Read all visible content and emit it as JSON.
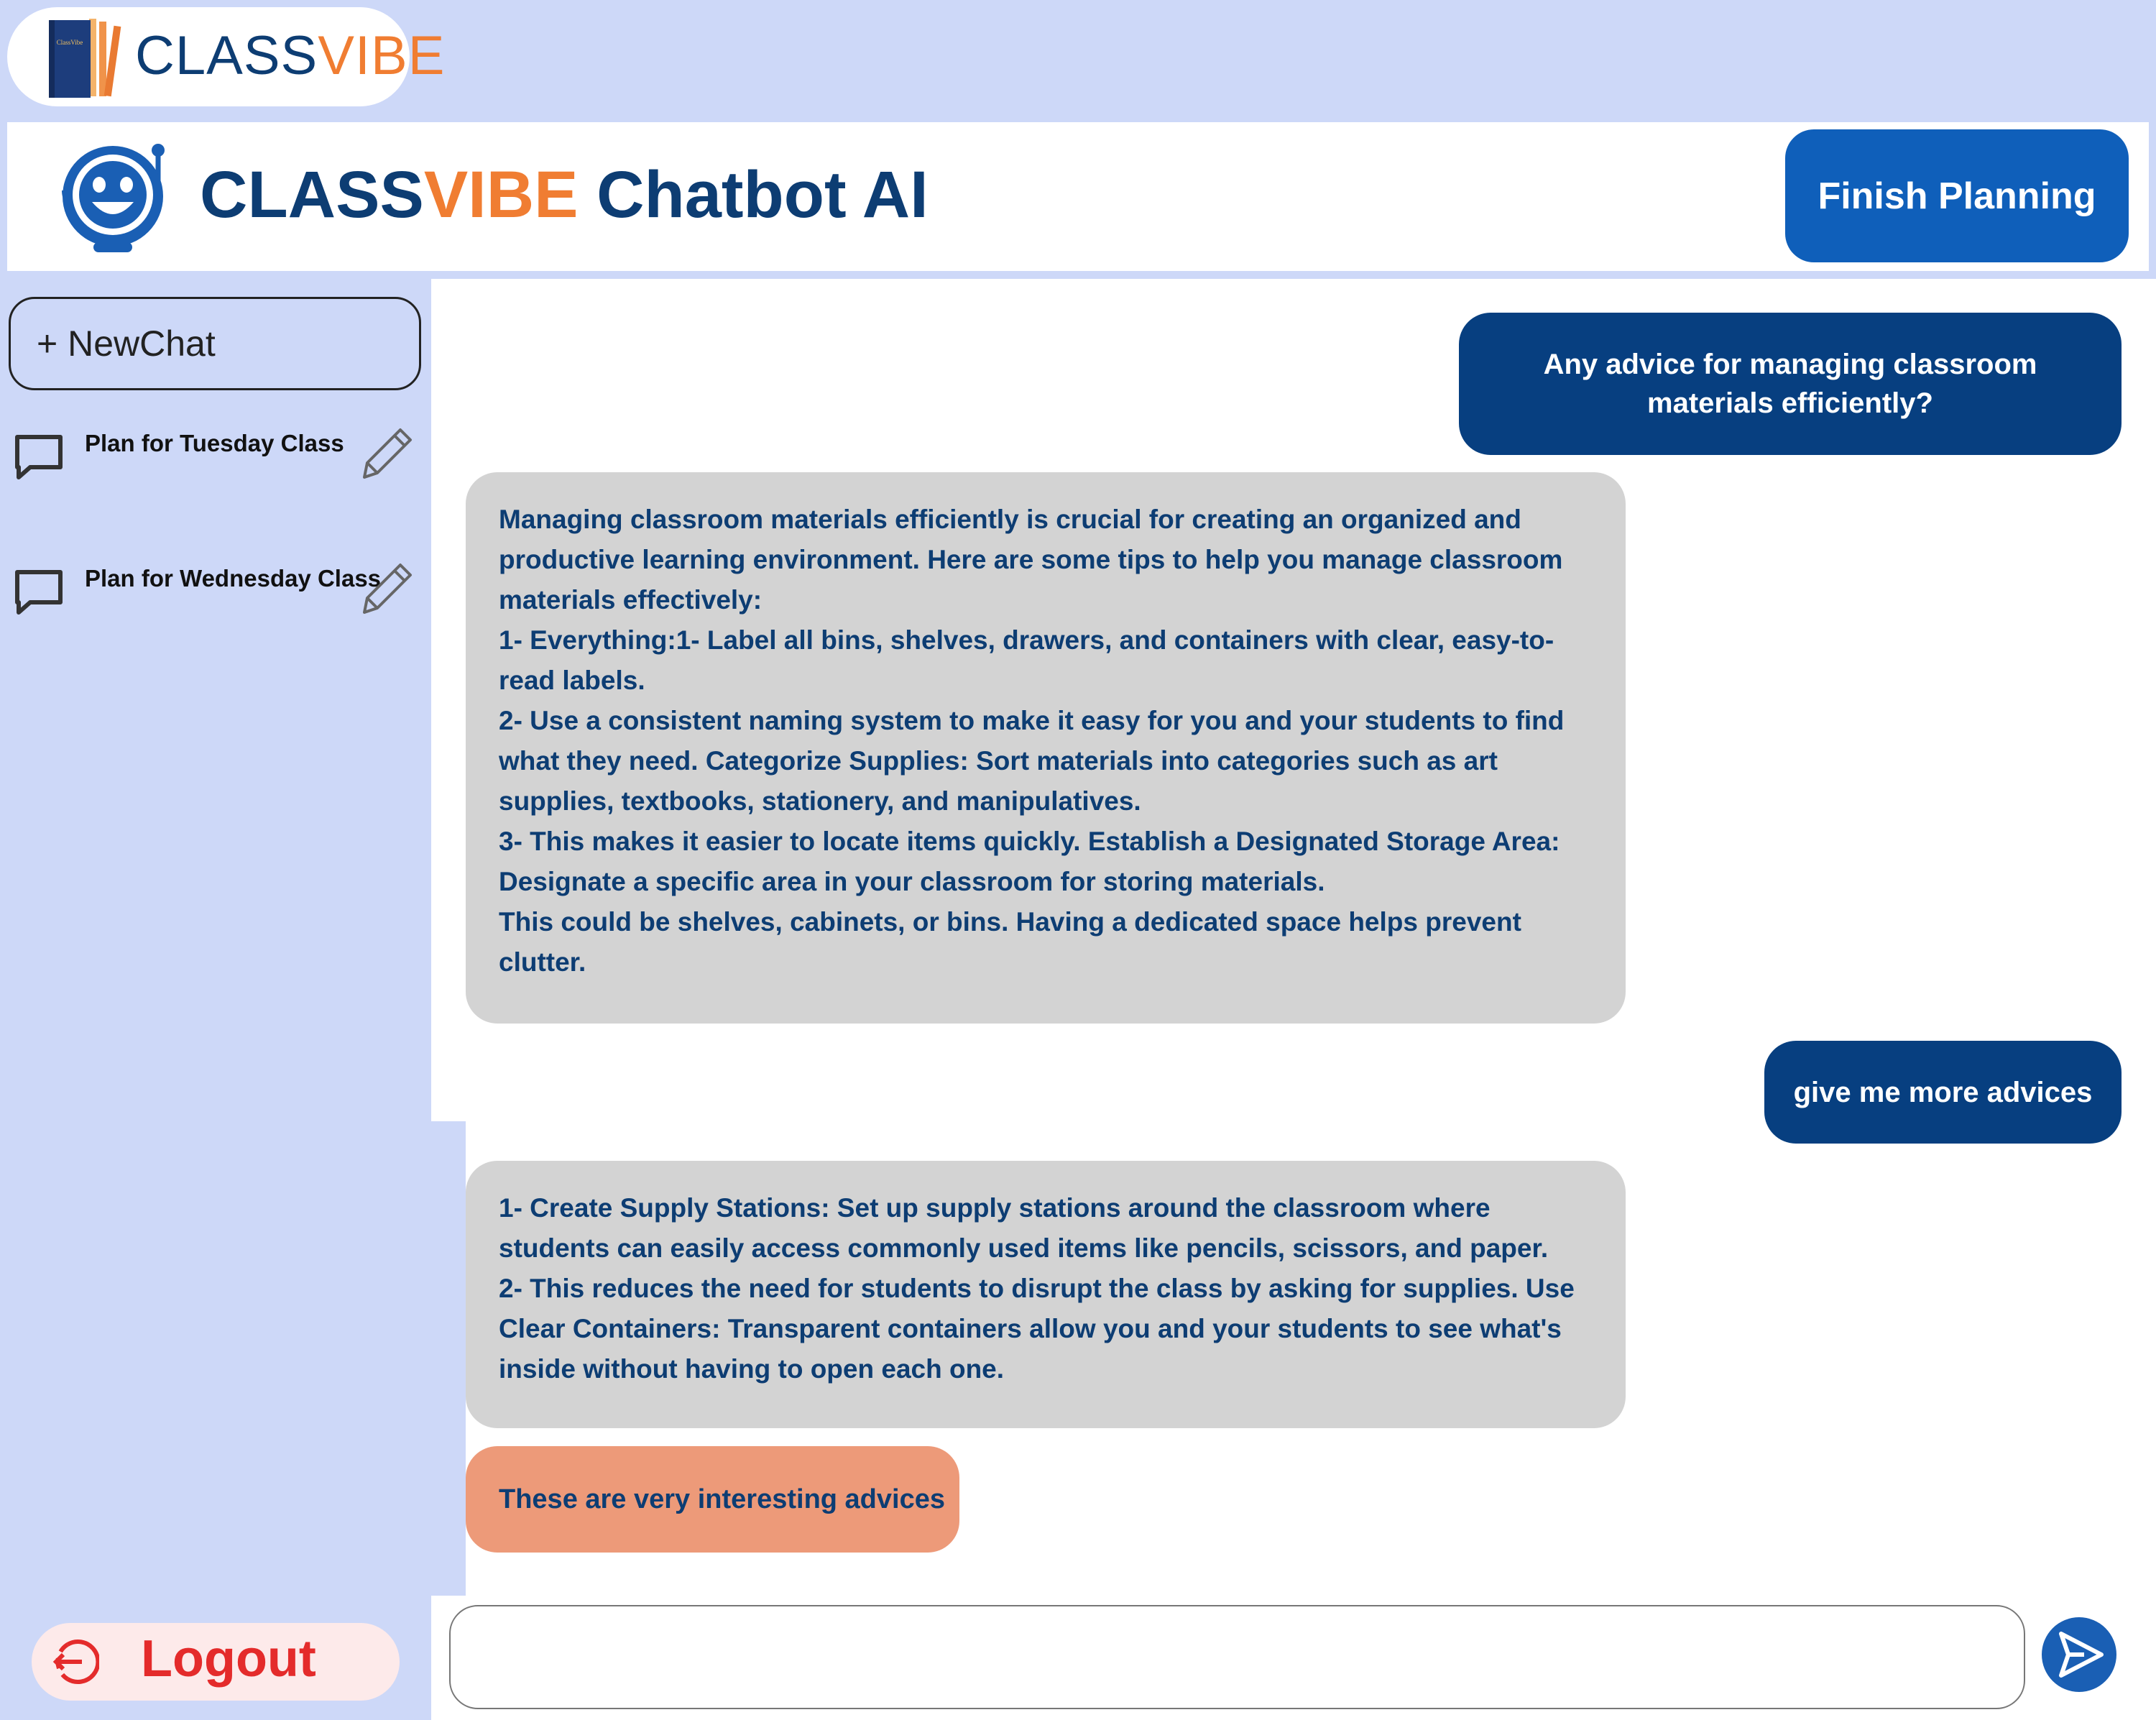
{
  "brand": {
    "logo_part1": "CLASS",
    "logo_part2": "VIBE",
    "book_text": "ClassVibe"
  },
  "header": {
    "title_part1": "CLASS",
    "title_part2": "VIBE",
    "title_part3": " Chatbot AI",
    "finish_button": "Finish Planning"
  },
  "sidebar": {
    "new_chat": "+ NewChat",
    "history": [
      {
        "label": "Plan for Tuesday Class"
      },
      {
        "label": "Plan for Wednesday Class"
      }
    ],
    "logout": "Logout"
  },
  "messages": [
    {
      "role": "user",
      "text": "Any advice for managing classroom materials efficiently?"
    },
    {
      "role": "bot",
      "text": "Managing classroom materials efficiently is crucial for creating an organized and productive learning environment. Here are some tips to help you manage classroom materials effectively:\n1- Everything:1- Label all bins, shelves, drawers, and containers with clear, easy-to-read labels.\n2- Use a consistent naming system to make it easy for you and your students to find what they need. Categorize Supplies: Sort materials into categories such as art supplies, textbooks, stationery, and manipulatives.\n3- This makes it easier to locate items quickly. Establish a Designated Storage Area: Designate a specific area in your classroom for storing materials.\nThis could be shelves, cabinets, or bins. Having a dedicated space helps prevent clutter."
    },
    {
      "role": "user",
      "text": "give me more advices"
    },
    {
      "role": "bot",
      "text": "1- Create Supply Stations: Set up supply stations around the classroom where students can easily access commonly used items like pencils, scissors, and paper.\n2- This reduces the need for students to disrupt the class by asking for supplies. Use Clear Containers: Transparent containers allow you and your students to see what's inside without having to open each one."
    },
    {
      "role": "suggestion",
      "text": "These are very interesting advices"
    }
  ],
  "input": {
    "placeholder": ""
  },
  "colors": {
    "navy": "#073f80",
    "orange": "#f07d32",
    "background": "#cdd8f8",
    "bot_bubble": "#d3d3d3",
    "suggestion_bubble": "#ed9a79",
    "logout_red": "#e42b2b"
  },
  "icons": [
    "classvibe-book-logo",
    "robot-icon",
    "chat-bubble-icon",
    "pencil-icon",
    "logout-icon",
    "send-icon"
  ]
}
